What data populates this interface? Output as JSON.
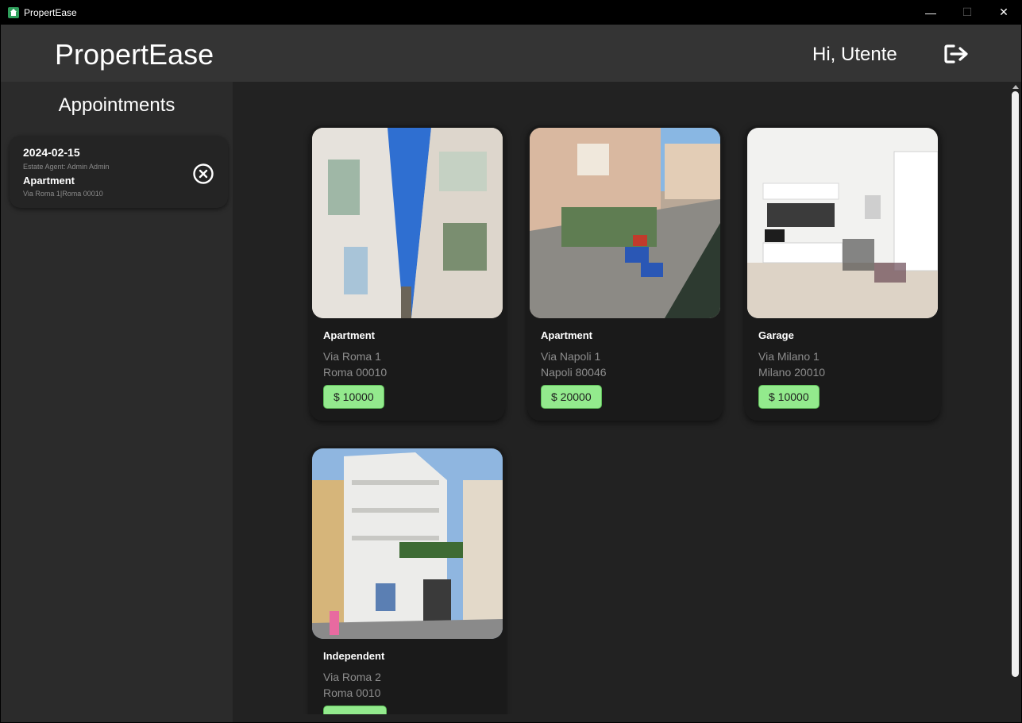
{
  "window": {
    "title": "PropertEase",
    "icon": "house-icon",
    "controls": {
      "minimize": "—",
      "maximize": "☐",
      "close": "✕"
    }
  },
  "header": {
    "brand": "PropertEase",
    "greeting": "Hi, Utente",
    "logout_icon": "logout-icon"
  },
  "sidebar": {
    "title": "Appointments",
    "appointments": [
      {
        "date": "2024-02-15",
        "agent": "Estate Agent: Admin Admin",
        "type": "Apartment",
        "address": "Via Roma 1|Roma 00010",
        "cancel_icon": "close-circle-icon"
      }
    ]
  },
  "listings": [
    {
      "type": "Apartment",
      "street": "Via Roma 1",
      "city": "Roma 00010",
      "price": "$ 10000",
      "photo": "narrow-street-photo"
    },
    {
      "type": "Apartment",
      "street": "Via Napoli 1",
      "city": "Napoli 80046",
      "price": "$ 20000",
      "photo": "balcony-street-photo"
    },
    {
      "type": "Garage",
      "street": "Via Milano 1",
      "city": "Milano 20010",
      "price": "$ 10000",
      "photo": "kitchen-interior-photo"
    },
    {
      "type": "Independent",
      "street": "Via Roma 2",
      "city": "Roma 0010",
      "price": "",
      "photo": "building-facade-photo"
    }
  ],
  "colors": {
    "header_bg": "#343434",
    "sidebar_bg": "#2b2b2b",
    "main_bg": "#222222",
    "card_bg": "#1a1a1a",
    "price_bg": "#93ea8d",
    "app_icon": "#2e9e5b"
  }
}
